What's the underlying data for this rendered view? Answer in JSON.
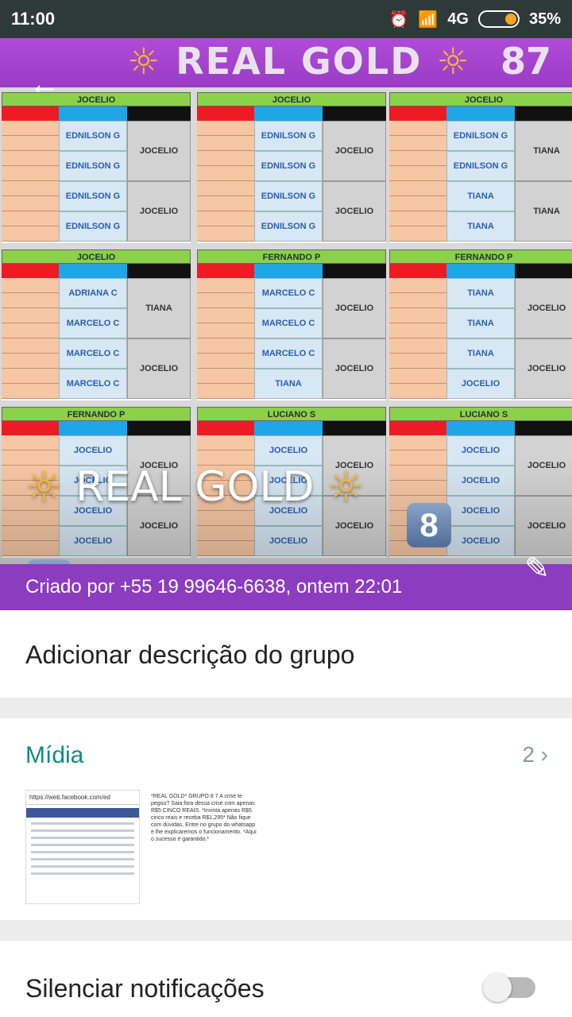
{
  "status": {
    "time": "11:00",
    "network": "4G",
    "battery": "35%"
  },
  "banner": {
    "title": "REAL GOLD",
    "number": "87"
  },
  "blocks": [
    {
      "header": "JOCELIO",
      "blue": [
        "EDNILSON G",
        "EDNILSON G",
        "EDNILSON G",
        "EDNILSON G"
      ],
      "grey": [
        "JOCELIO",
        "JOCELIO"
      ]
    },
    {
      "header": "JOCELIO",
      "blue": [
        "EDNILSON G",
        "EDNILSON G",
        "EDNILSON G",
        "EDNILSON G"
      ],
      "grey": [
        "JOCELIO",
        "JOCELIO"
      ]
    },
    {
      "header": "JOCELIO",
      "blue": [
        "EDNILSON G",
        "EDNILSON G",
        "TIANA",
        "TIANA"
      ],
      "grey": [
        "TIANA",
        "TIANA"
      ]
    },
    {
      "header": "JOCELIO",
      "blue": [
        "ADRIANA C",
        "MARCELO C",
        "MARCELO C",
        "MARCELO C"
      ],
      "grey": [
        "TIANA",
        "JOCELIO"
      ]
    },
    {
      "header": "FERNANDO P",
      "blue": [
        "MARCELO C",
        "MARCELO C",
        "MARCELO C",
        "TIANA"
      ],
      "grey": [
        "JOCELIO",
        "JOCELIO"
      ]
    },
    {
      "header": "FERNANDO P",
      "blue": [
        "TIANA",
        "TIANA",
        "TIANA",
        "JOCELIO"
      ],
      "grey": [
        "JOCELIO",
        "JOCELIO"
      ]
    },
    {
      "header": "FERNANDO P",
      "blue": [
        "JOCELIO",
        "JOCELIO",
        "JOCELIO",
        "JOCELIO"
      ],
      "grey": [
        "JOCELIO",
        "JOCELIO"
      ]
    },
    {
      "header": "LUCIANO S",
      "blue": [
        "JOCELIO",
        "JOCELIO",
        "JOCELIO",
        "JOCELIO"
      ],
      "grey": [
        "JOCELIO",
        "JOCELIO"
      ]
    },
    {
      "header": "LUCIANO S",
      "blue": [
        "JOCELIO",
        "JOCELIO",
        "JOCELIO",
        "JOCELIO"
      ],
      "grey": [
        "JOCELIO",
        "JOCELIO"
      ]
    }
  ],
  "group": {
    "name": "REAL GOLD",
    "badge8": "8",
    "badge7": "7",
    "created": "Criado por +55 19 99646-6638, ontem 22:01"
  },
  "description": {
    "label": "Adicionar descrição do grupo"
  },
  "media": {
    "title": "Mídia",
    "count": "2",
    "thumb1_url": "https://web.facebook.com/ed",
    "thumb2_text": "*REAL GOLD* GRUPO 8 7 A crise te pegou? Saia fora dessa crise com apenas R$5 CINCO REAIS. *Invista apenas R$5 cinco reais e receba R$1,295* Não fique com dúvidas, Entre no grupo do whatsapp e lhe explicaremos o funcionamento. *Aqui o sucesso é garantido.*"
  },
  "mute": {
    "label": "Silenciar notificações"
  },
  "colors": {
    "accent": "#128c7e",
    "purple": "#8c3cbf",
    "statusbar": "#2d3a37"
  }
}
